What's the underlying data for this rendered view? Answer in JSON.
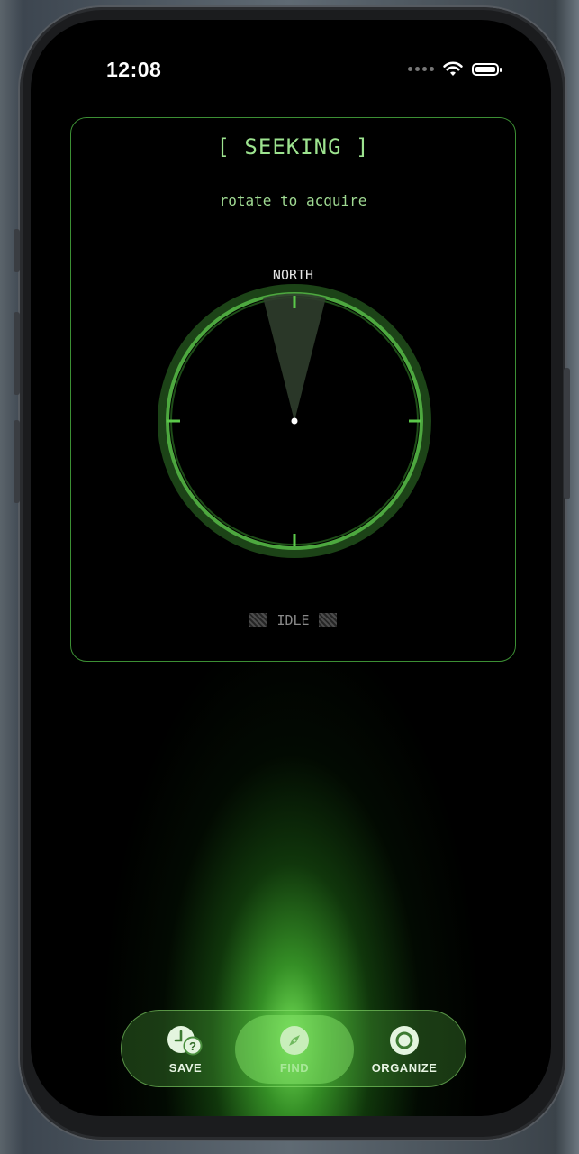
{
  "status_bar": {
    "time": "12:08",
    "icons": [
      "signal-dots-icon",
      "wifi-icon",
      "battery-icon"
    ]
  },
  "card": {
    "title": "[ SEEKING ]",
    "subtitle": "rotate to acquire",
    "compass_label": "NORTH",
    "status_text": "IDLE"
  },
  "tabbar": {
    "tabs": [
      {
        "label": "SAVE",
        "icon": "clock-question-icon",
        "selected": false
      },
      {
        "label": "FIND",
        "icon": "compass-icon",
        "selected": true
      },
      {
        "label": "ORGANIZE",
        "icon": "target-icon",
        "selected": false
      }
    ]
  },
  "colors": {
    "accent": "#5bc94a",
    "text_green": "#9de38f",
    "background": "#000000"
  }
}
